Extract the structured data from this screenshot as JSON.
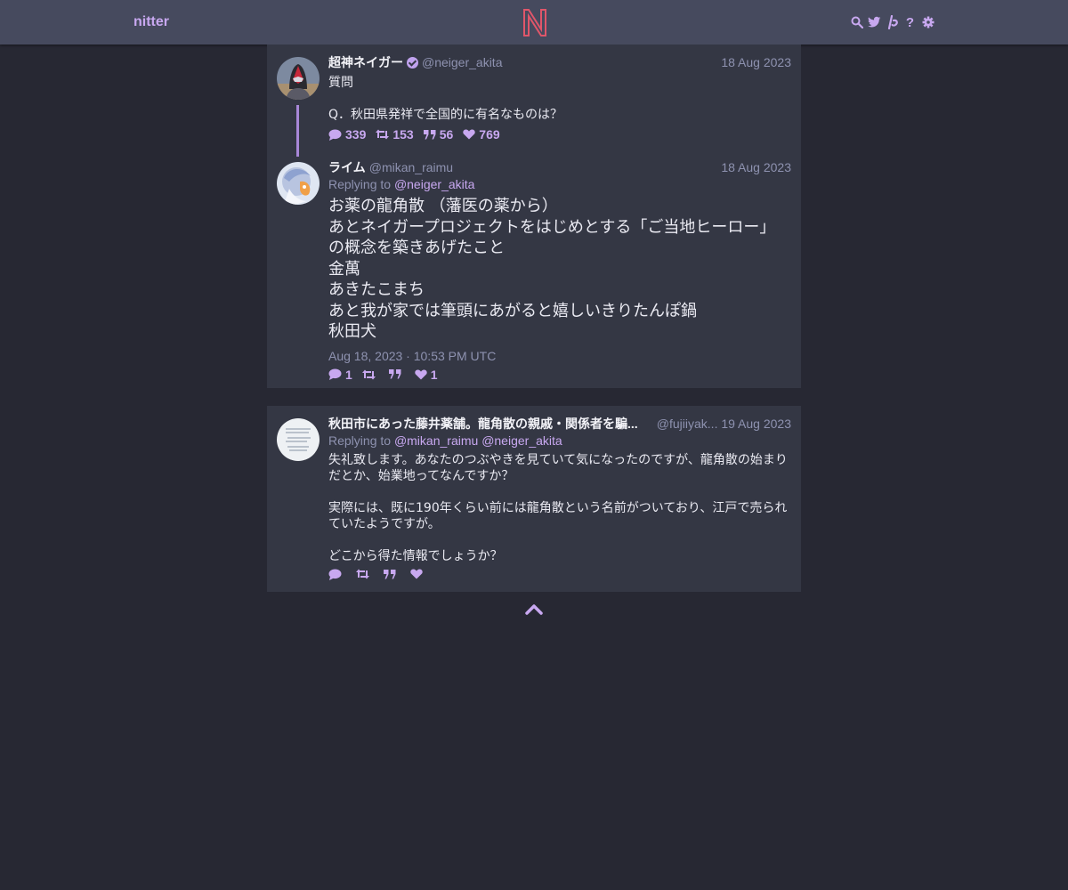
{
  "navbar": {
    "brand": "nitter",
    "logo_letter": "N",
    "icons": [
      "search-icon",
      "twitter-icon",
      "rss-icon",
      "help-icon",
      "settings-icon"
    ],
    "help_glyph": "?"
  },
  "colors": {
    "accent": "#c8a8f0",
    "background": "#272833",
    "card": "#343744",
    "navbar": "#464a5e",
    "muted": "#8e92b0",
    "logo": "#e0566a"
  },
  "thread": [
    {
      "fullname": "超神ネイガー",
      "verified": true,
      "username": "@neiger_akita",
      "date": "18 Aug 2023",
      "content": "質問\n\nQ．秋田県発祥で全国的に有名なものは？",
      "stats": {
        "replies": "339",
        "retweets": "153",
        "quotes": "56",
        "likes": "769"
      }
    },
    {
      "fullname": "ライム",
      "username": "@mikan_raimu",
      "date": "18 Aug 2023",
      "replying_prefix": "Replying to",
      "replying_to": [
        "@neiger_akita"
      ],
      "content": "お薬の龍角散 （藩医の薬から）\nあとネイガープロジェクトをはじめとする「ご当地ヒーロー」の概念を築きあげたこと\n金萬\nあきたこまち\nあと我が家では筆頭にあがると嬉しいきりたんぽ鍋\n秋田犬",
      "published": "Aug 18, 2023 · 10:53 PM UTC",
      "stats": {
        "replies": "1",
        "retweets": "",
        "quotes": "",
        "likes": "1"
      }
    }
  ],
  "replies": [
    {
      "fullname": "秋田市にあった藤井薬舗。龍角散の親戚・関係者を騙...",
      "username": "@fujiiyak...",
      "date": "19 Aug 2023",
      "replying_prefix": "Replying to",
      "replying_to": [
        "@mikan_raimu",
        "@neiger_akita"
      ],
      "content": "失礼致します。あなたのつぶやきを見ていて気になったのですが、龍角散の始まりだとか、始業地ってなんですか？\n\n実際には、既に190年くらい前には龍角散という名前がついており、江戸で売られていたようですが。\n\nどこから得た情報でしょうか？",
      "stats": {
        "replies": "",
        "retweets": "",
        "quotes": "",
        "likes": ""
      }
    }
  ]
}
